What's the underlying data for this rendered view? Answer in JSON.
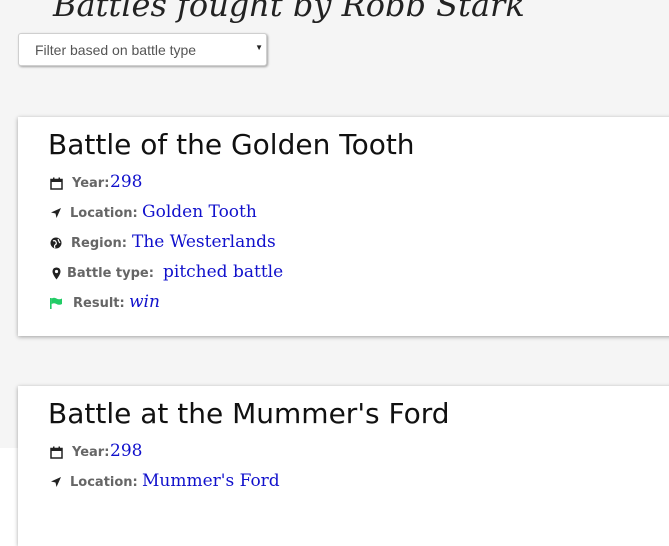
{
  "page": {
    "title": "Battles fought by Robb Stark",
    "filter": {
      "selected": "Filter based on battle type"
    }
  },
  "labels": {
    "year": "Year:",
    "location": "Location:",
    "region": "Region:",
    "battle_type": "Battle type:",
    "result": "Result:"
  },
  "battles": [
    {
      "name": "Battle of the Golden Tooth",
      "year": "298",
      "location": "Golden Tooth",
      "region": "The Westerlands",
      "battle_type": "pitched battle",
      "result": "win"
    },
    {
      "name": "Battle at the Mummer's Ford",
      "year": "298",
      "location": "Mummer's Ford"
    }
  ],
  "icons": {
    "year": "calendar-icon",
    "location": "location-arrow-icon",
    "region": "globe-icon",
    "battle_type": "map-marker-icon",
    "result": "flag-icon"
  },
  "colors": {
    "value_text": "#1111cc",
    "result_flag": "#22cc66",
    "label_text": "#666666"
  }
}
